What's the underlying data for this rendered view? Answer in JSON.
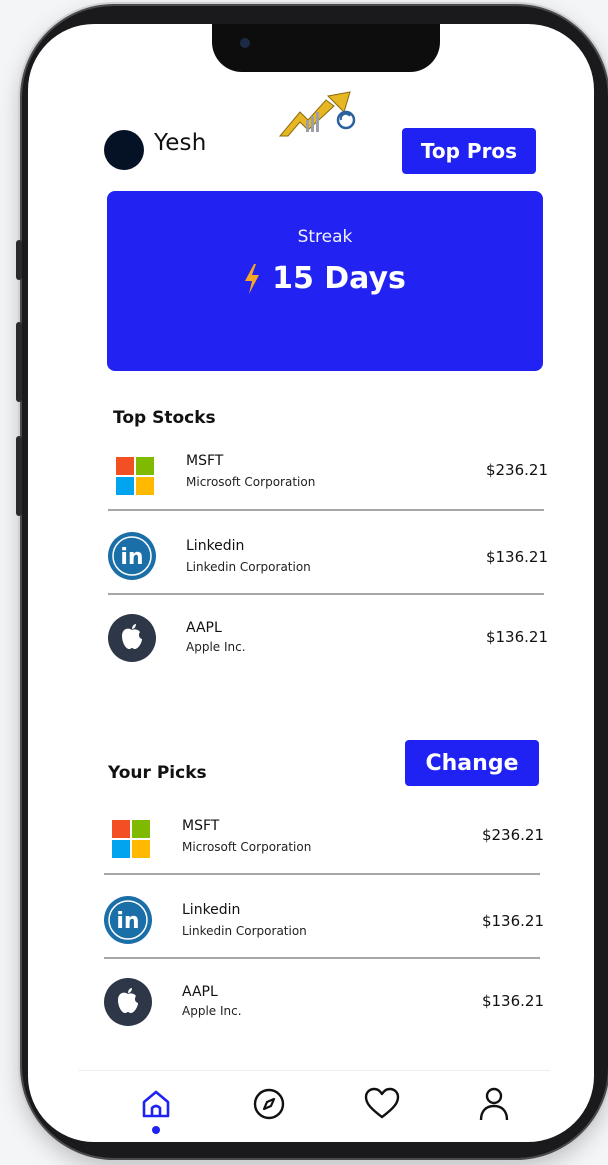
{
  "header": {
    "username": "Yesh",
    "top_pros_label": "Top Pros"
  },
  "streak": {
    "label": "Streak",
    "value": "15 Days"
  },
  "top_stocks": {
    "title": "Top Stocks",
    "items": [
      {
        "symbol": "MSFT",
        "name": "Microsoft Corporation",
        "price": "$236.21",
        "icon": "microsoft-logo-icon"
      },
      {
        "symbol": "Linkedin",
        "name": "Linkedin Corporation",
        "price": "$136.21",
        "icon": "linkedin-logo-icon"
      },
      {
        "symbol": "AAPL",
        "name": "Apple Inc.",
        "price": "$136.21",
        "icon": "apple-logo-icon"
      }
    ]
  },
  "your_picks": {
    "title": "Your Picks",
    "change_label": "Change",
    "items": [
      {
        "symbol": "MSFT",
        "name": "Microsoft Corporation",
        "price": "$236.21",
        "icon": "microsoft-logo-icon"
      },
      {
        "symbol": "Linkedin",
        "name": "Linkedin Corporation",
        "price": "$136.21",
        "icon": "linkedin-logo-icon"
      },
      {
        "symbol": "AAPL",
        "name": "Apple Inc.",
        "price": "$136.21",
        "icon": "apple-logo-icon"
      }
    ]
  },
  "tabbar": {
    "tabs": [
      {
        "icon": "home-icon",
        "active": true
      },
      {
        "icon": "compass-icon",
        "active": false
      },
      {
        "icon": "heart-icon",
        "active": false
      },
      {
        "icon": "profile-icon",
        "active": false
      }
    ]
  },
  "colors": {
    "accent": "#1f22f2",
    "avatar": "#051226",
    "linkedin": "#1b6fa8",
    "apple_badge": "#2d3748"
  }
}
